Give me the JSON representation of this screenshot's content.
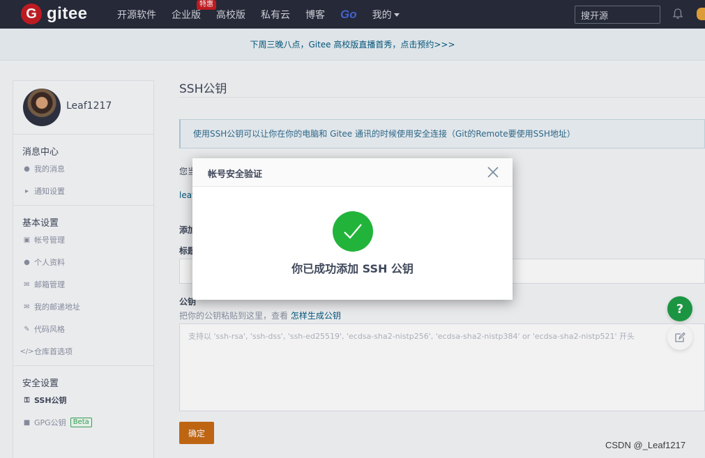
{
  "header": {
    "logo_letter": "G",
    "logo_text": "gitee",
    "nav": [
      {
        "label": "开源软件"
      },
      {
        "label": "企业版",
        "badge": "特惠"
      },
      {
        "label": "高校版"
      },
      {
        "label": "私有云"
      },
      {
        "label": "博客"
      },
      {
        "label": "Go"
      },
      {
        "label": "我的"
      }
    ],
    "search_placeholder": "搜开源"
  },
  "banner": {
    "text": "下周三晚八点，Gitee 高校版直播首秀，点击预约>>>"
  },
  "sidebar": {
    "username": "Leaf1217",
    "sections": [
      {
        "title": "消息中心",
        "items": [
          {
            "label": "我的消息",
            "icon": "bell-icon"
          },
          {
            "label": "通知设置",
            "icon": "speaker-icon"
          }
        ]
      },
      {
        "title": "基本设置",
        "items": [
          {
            "label": "帐号管理",
            "icon": "id-card-icon"
          },
          {
            "label": "个人资料",
            "icon": "user-icon"
          },
          {
            "label": "邮箱管理",
            "icon": "mail-icon"
          },
          {
            "label": "我的邮递地址",
            "icon": "mail-icon"
          },
          {
            "label": "代码风格",
            "icon": "brush-icon"
          },
          {
            "label": "仓库首选项",
            "icon": "code-icon"
          }
        ]
      },
      {
        "title": "安全设置",
        "items": [
          {
            "label": "SSH公钥",
            "icon": "key-icon",
            "active": true
          },
          {
            "label": "GPG公钥",
            "icon": "lock-icon",
            "badge": "Beta"
          }
        ]
      }
    ]
  },
  "main": {
    "title": "SSH公钥",
    "info": "使用SSH公钥可以让你在你的电脑和 Gitee 通讯的时候使用安全连接（Git的Remote要使用SSH地址）",
    "stub_1": "您当",
    "stub_2": "leaf",
    "stub_3": "添加",
    "stub_4": "标题",
    "key_label": "公钥",
    "key_hint": "把你的公钥粘贴到这里，查看",
    "key_hint_link": "怎样生成公钥",
    "key_placeholder": "支持以 'ssh-rsa', 'ssh-dss', 'ssh-ed25519', 'ecdsa-sha2-nistp256', 'ecdsa-sha2-nistp384' or 'ecdsa-sha2-nistp521' 开头",
    "confirm_label": "确定"
  },
  "floating": {
    "help_label": "?"
  },
  "modal": {
    "title": "帐号安全验证",
    "message": "你已成功添加 SSH 公钥"
  },
  "watermark": "CSDN @_Leaf1217",
  "colors": {
    "header_bg": "#272c3b",
    "brand_red": "#c71d23",
    "success_green": "#22b43a",
    "confirm_orange": "#c96b15",
    "help_green": "#1e9d47"
  }
}
